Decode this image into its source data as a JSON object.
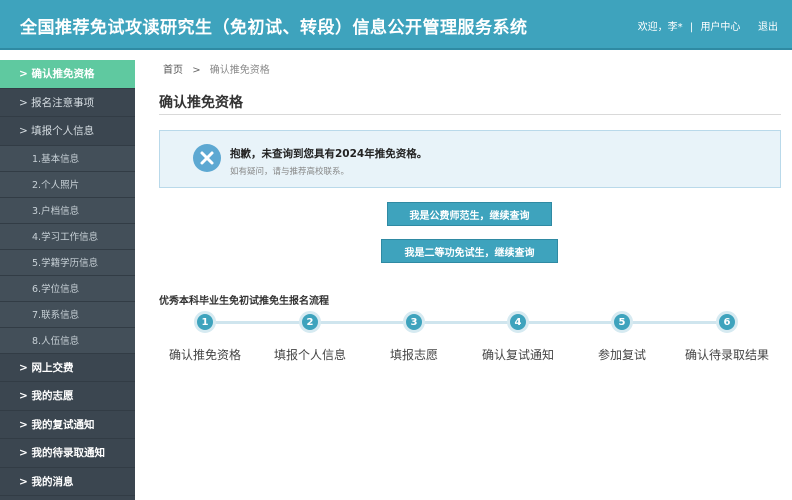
{
  "header": {
    "title": "全国推荐免试攻读研究生（免初试、转段）信息公开管理服务系统",
    "welcome": "欢迎，李*",
    "separator": "|",
    "user_center": "用户中心",
    "logout": "退出"
  },
  "sidebar": {
    "items": [
      {
        "label": "> 确认推免资格"
      },
      {
        "label": "> 报名注意事项"
      },
      {
        "label": "> 填报个人信息"
      },
      {
        "label": "1.基本信息"
      },
      {
        "label": "2.个人照片"
      },
      {
        "label": "3.户档信息"
      },
      {
        "label": "4.学习工作信息"
      },
      {
        "label": "5.学籍学历信息"
      },
      {
        "label": "6.学位信息"
      },
      {
        "label": "7.联系信息"
      },
      {
        "label": "8.人伍信息"
      },
      {
        "label": "> 网上交费"
      },
      {
        "label": "> 我的志愿"
      },
      {
        "label": "> 我的复试通知"
      },
      {
        "label": "> 我的待录取通知"
      },
      {
        "label": "> 我的消息"
      }
    ]
  },
  "breadcrumb": {
    "home": "首页",
    "sep": ">",
    "current": "确认推免资格"
  },
  "page_title": "确认推免资格",
  "alert": {
    "message": "抱歉，未查询到您具有2024年推免资格。",
    "hint": "如有疑问，请与推荐高校联系。"
  },
  "buttons": {
    "public_normal": "我是公费师范生，继续查询",
    "second_class_merit": "我是二等功免试生，继续查询"
  },
  "flow": {
    "title": "优秀本科毕业生免初试推免生报名流程",
    "steps": [
      {
        "num": "1",
        "label": "确认推免资格"
      },
      {
        "num": "2",
        "label": "填报个人信息"
      },
      {
        "num": "3",
        "label": "填报志愿"
      },
      {
        "num": "4",
        "label": "确认复试通知"
      },
      {
        "num": "5",
        "label": "参加复试"
      },
      {
        "num": "6",
        "label": "确认待录取结果"
      }
    ]
  },
  "colors": {
    "header_bg": "#3ea3bd",
    "sidebar_bg": "#3b4650",
    "sidebar_active": "#5fc9a0",
    "alert_bg": "#e8f3f9",
    "error_icon": "#5da8d2"
  }
}
